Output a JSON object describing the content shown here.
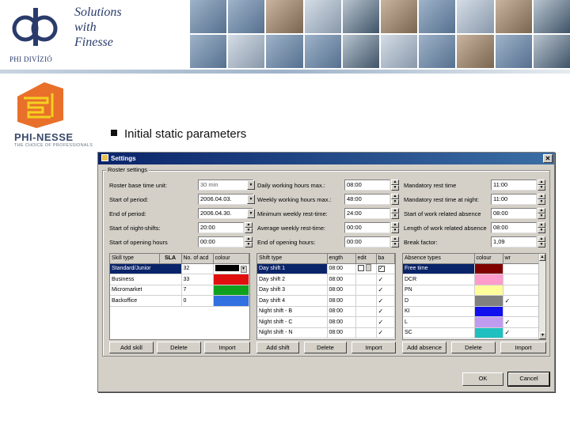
{
  "header": {
    "logo_caption": "PHI DIVÍZIÓ",
    "tagline": [
      "Solutions",
      "with",
      "Finesse"
    ]
  },
  "brand": {
    "name": "PHI-NESSE",
    "subtitle": "THE CHOICE OF PROFESSIONALS"
  },
  "bullet": "Initial static parameters",
  "window": {
    "title": "Settings",
    "close_label": "✕",
    "group_title": "Roster settings",
    "params": {
      "col1": [
        {
          "label": "Roster base time unit:",
          "value": "30 min",
          "control": "dropdown"
        },
        {
          "label": "Start of period:",
          "value": "2006.04.03.",
          "control": "dropdown"
        },
        {
          "label": "End of period:",
          "value": "2006.04.30.",
          "control": "dropdown"
        },
        {
          "label": "Start of night-shifts:",
          "value": "20:00",
          "control": "spin"
        },
        {
          "label": "Start of opening hours",
          "value": "00:00",
          "control": "spin"
        }
      ],
      "col2": [
        {
          "label": "Daily working hours max.:",
          "value": "08:00"
        },
        {
          "label": "Weekly working hours max.:",
          "value": "48:00"
        },
        {
          "label": "Minimum weekly rest-time:",
          "value": "24:00"
        },
        {
          "label": "Average weekly rest-time:",
          "value": "00:00"
        },
        {
          "label": "End of opening hours:",
          "value": "00:00"
        }
      ],
      "col3": [
        {
          "label": "Mandatory rest time",
          "value": "11:00"
        },
        {
          "label": "Mandatory rest time at night:",
          "value": "11:00"
        },
        {
          "label": "Start of work related absence",
          "value": "08:00"
        },
        {
          "label": "Length of work related absence",
          "value": "08:00"
        },
        {
          "label": "Break factor:",
          "value": "1,09"
        }
      ]
    },
    "skill_table": {
      "headers": [
        "Skill type",
        "SLA",
        "No. of acd",
        "colour"
      ],
      "rows": [
        {
          "name": "Standard/Junior",
          "num": "32",
          "color": "#000000"
        },
        {
          "name": "Business",
          "num": "33",
          "color": "#e01010"
        },
        {
          "name": "Micromarket",
          "num": "7",
          "color": "#10a020"
        },
        {
          "name": "Backoffice",
          "num": "0",
          "color": "#3070e0"
        }
      ],
      "buttons": [
        "Add skill",
        "Delete",
        "Import"
      ]
    },
    "shift_table": {
      "headers": [
        "Shift type",
        "ength",
        "edit",
        "ba"
      ],
      "rows": [
        {
          "name": "Day shift 1",
          "length": "08:00",
          "checked": true
        },
        {
          "name": "Day shift 2",
          "length": "08:00",
          "checked": true
        },
        {
          "name": "Day shift 3",
          "length": "08:00",
          "checked": true
        },
        {
          "name": "Day shift 4",
          "length": "08:00",
          "checked": true
        },
        {
          "name": "Night shift - B",
          "length": "08:00",
          "checked": true
        },
        {
          "name": "Night shift - C",
          "length": "08:00",
          "checked": true
        },
        {
          "name": "Night shift - N",
          "length": "08:00",
          "checked": true
        }
      ],
      "buttons": [
        "Add shift",
        "Delete",
        "Import"
      ]
    },
    "absence_table": {
      "headers": [
        "Absence types",
        "colour",
        "wr"
      ],
      "rows": [
        {
          "name": "Free time",
          "color": "#800000",
          "checked": false
        },
        {
          "name": "DCR",
          "color": "#ff9ccc",
          "checked": false
        },
        {
          "name": "PN",
          "color": "#fffe9a",
          "checked": false
        },
        {
          "name": "D",
          "color": "#808080",
          "checked": true
        },
        {
          "name": "KI",
          "color": "#1010ee",
          "checked": false
        },
        {
          "name": "L",
          "color": "#c09cf0",
          "checked": true
        },
        {
          "name": "SC",
          "color": "#20c0c0",
          "checked": true
        }
      ],
      "buttons": [
        "Add absence",
        "Delete",
        "Import"
      ]
    },
    "ok_label": "OK",
    "cancel_label": "Cancel"
  }
}
